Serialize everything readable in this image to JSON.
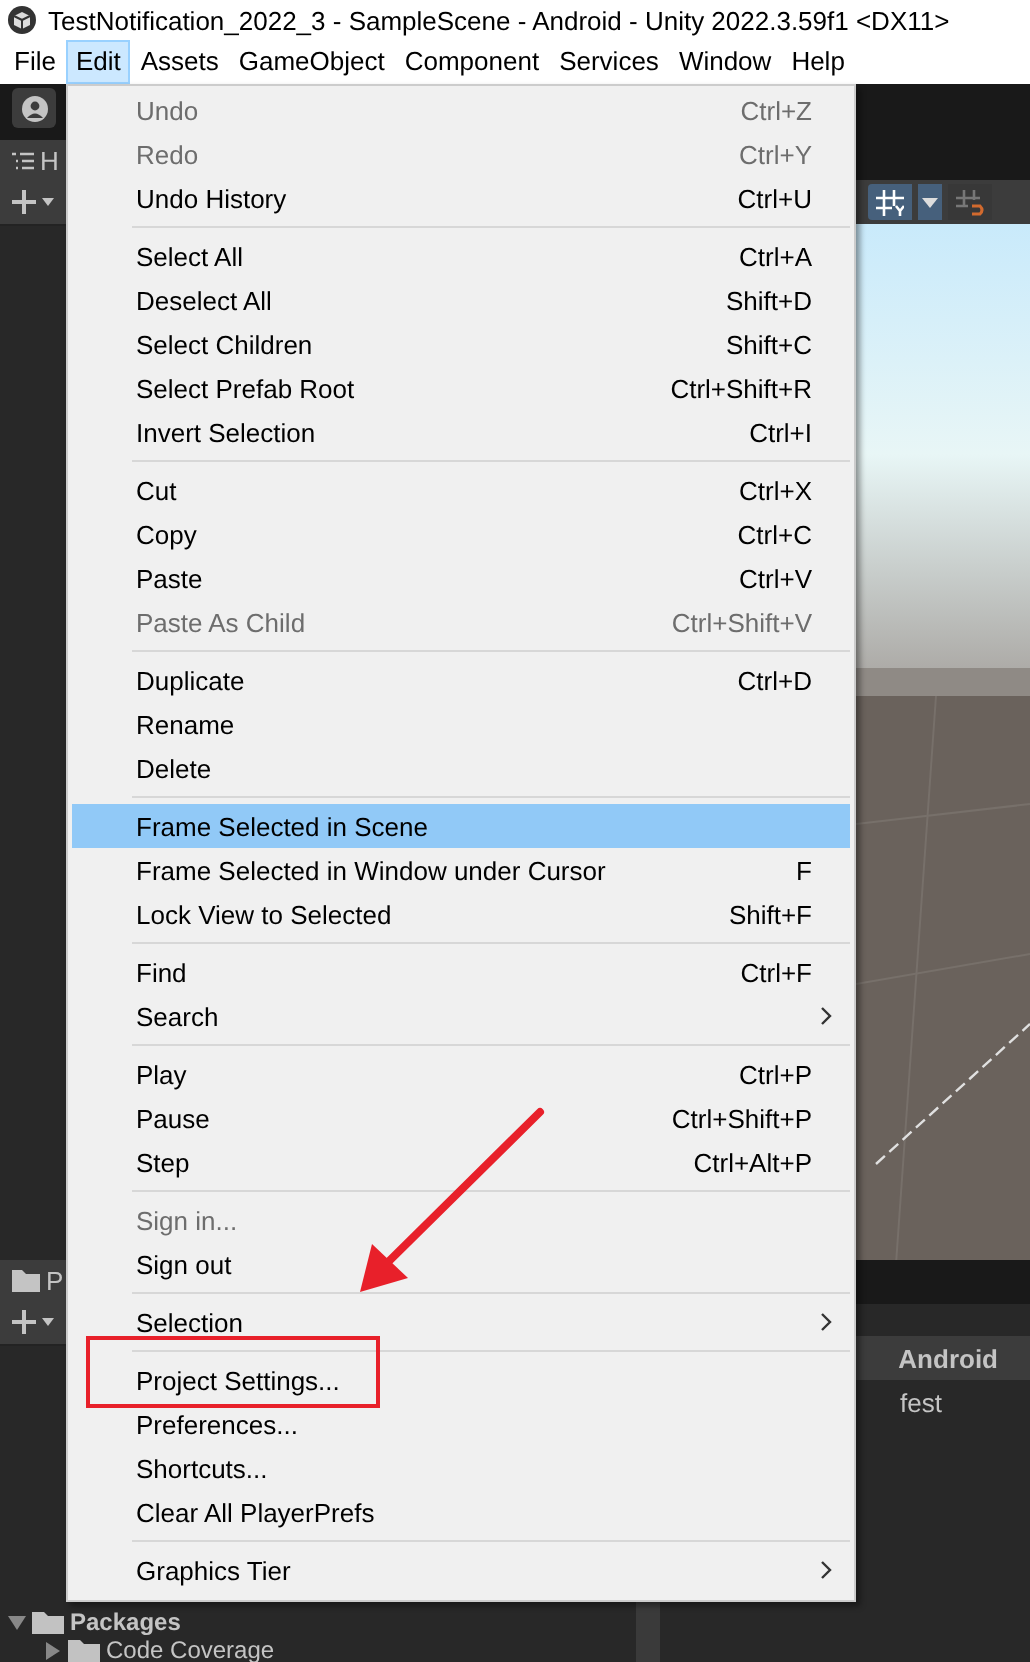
{
  "window": {
    "title": "TestNotification_2022_3 - SampleScene - Android - Unity 2022.3.59f1 <DX11>"
  },
  "menubar": [
    {
      "label": "File",
      "selected": false
    },
    {
      "label": "Edit",
      "selected": true
    },
    {
      "label": "Assets",
      "selected": false
    },
    {
      "label": "GameObject",
      "selected": false
    },
    {
      "label": "Component",
      "selected": false
    },
    {
      "label": "Services",
      "selected": false
    },
    {
      "label": "Window",
      "selected": false
    },
    {
      "label": "Help",
      "selected": false
    }
  ],
  "hierarchy": {
    "tab": "H"
  },
  "project": {
    "tab": "P",
    "tree": [
      {
        "label": "Packages",
        "expanded": true,
        "children": [
          {
            "label": "Code Coverage",
            "expanded": false
          }
        ]
      }
    ],
    "breadcrumb": "Android",
    "file": "fest"
  },
  "edit_menu": [
    {
      "kind": "item",
      "label": "Undo",
      "shortcut": "Ctrl+Z",
      "disabled": true,
      "selected": false
    },
    {
      "kind": "item",
      "label": "Redo",
      "shortcut": "Ctrl+Y",
      "disabled": true,
      "selected": false
    },
    {
      "kind": "item",
      "label": "Undo History",
      "shortcut": "Ctrl+U",
      "disabled": false,
      "selected": false
    },
    {
      "kind": "separator"
    },
    {
      "kind": "item",
      "label": "Select All",
      "shortcut": "Ctrl+A",
      "disabled": false,
      "selected": false
    },
    {
      "kind": "item",
      "label": "Deselect All",
      "shortcut": "Shift+D",
      "disabled": false,
      "selected": false
    },
    {
      "kind": "item",
      "label": "Select Children",
      "shortcut": "Shift+C",
      "disabled": false,
      "selected": false
    },
    {
      "kind": "item",
      "label": "Select Prefab Root",
      "shortcut": "Ctrl+Shift+R",
      "disabled": false,
      "selected": false
    },
    {
      "kind": "item",
      "label": "Invert Selection",
      "shortcut": "Ctrl+I",
      "disabled": false,
      "selected": false
    },
    {
      "kind": "separator"
    },
    {
      "kind": "item",
      "label": "Cut",
      "shortcut": "Ctrl+X",
      "disabled": false,
      "selected": false
    },
    {
      "kind": "item",
      "label": "Copy",
      "shortcut": "Ctrl+C",
      "disabled": false,
      "selected": false
    },
    {
      "kind": "item",
      "label": "Paste",
      "shortcut": "Ctrl+V",
      "disabled": false,
      "selected": false
    },
    {
      "kind": "item",
      "label": "Paste As Child",
      "shortcut": "Ctrl+Shift+V",
      "disabled": true,
      "selected": false
    },
    {
      "kind": "separator"
    },
    {
      "kind": "item",
      "label": "Duplicate",
      "shortcut": "Ctrl+D",
      "disabled": false,
      "selected": false
    },
    {
      "kind": "item",
      "label": "Rename",
      "disabled": false,
      "selected": false
    },
    {
      "kind": "item",
      "label": "Delete",
      "disabled": false,
      "selected": false
    },
    {
      "kind": "separator"
    },
    {
      "kind": "item",
      "label": "Frame Selected in Scene",
      "disabled": false,
      "selected": true
    },
    {
      "kind": "item",
      "label": "Frame Selected in Window under Cursor",
      "shortcut": "F",
      "disabled": false,
      "selected": false
    },
    {
      "kind": "item",
      "label": "Lock View to Selected",
      "shortcut": "Shift+F",
      "disabled": false,
      "selected": false
    },
    {
      "kind": "separator"
    },
    {
      "kind": "item",
      "label": "Find",
      "shortcut": "Ctrl+F",
      "disabled": false,
      "selected": false
    },
    {
      "kind": "submenu",
      "label": "Search",
      "disabled": false,
      "selected": false
    },
    {
      "kind": "separator"
    },
    {
      "kind": "item",
      "label": "Play",
      "shortcut": "Ctrl+P",
      "disabled": false,
      "selected": false
    },
    {
      "kind": "item",
      "label": "Pause",
      "shortcut": "Ctrl+Shift+P",
      "disabled": false,
      "selected": false
    },
    {
      "kind": "item",
      "label": "Step",
      "shortcut": "Ctrl+Alt+P",
      "disabled": false,
      "selected": false
    },
    {
      "kind": "separator"
    },
    {
      "kind": "item",
      "label": "Sign in...",
      "disabled": true,
      "selected": false
    },
    {
      "kind": "item",
      "label": "Sign out",
      "disabled": false,
      "selected": false
    },
    {
      "kind": "separator"
    },
    {
      "kind": "submenu",
      "label": "Selection",
      "disabled": false,
      "selected": false
    },
    {
      "kind": "separator"
    },
    {
      "kind": "item",
      "label": "Project Settings...",
      "disabled": false,
      "selected": false
    },
    {
      "kind": "item",
      "label": "Preferences...",
      "disabled": false,
      "selected": false
    },
    {
      "kind": "item",
      "label": "Shortcuts...",
      "disabled": false,
      "selected": false
    },
    {
      "kind": "item",
      "label": "Clear All PlayerPrefs",
      "disabled": false,
      "selected": false
    },
    {
      "kind": "separator"
    },
    {
      "kind": "submenu",
      "label": "Graphics Tier",
      "disabled": false,
      "selected": false
    }
  ],
  "annotations": [
    {
      "kind": "arrow"
    },
    {
      "kind": "highlight-box"
    }
  ]
}
